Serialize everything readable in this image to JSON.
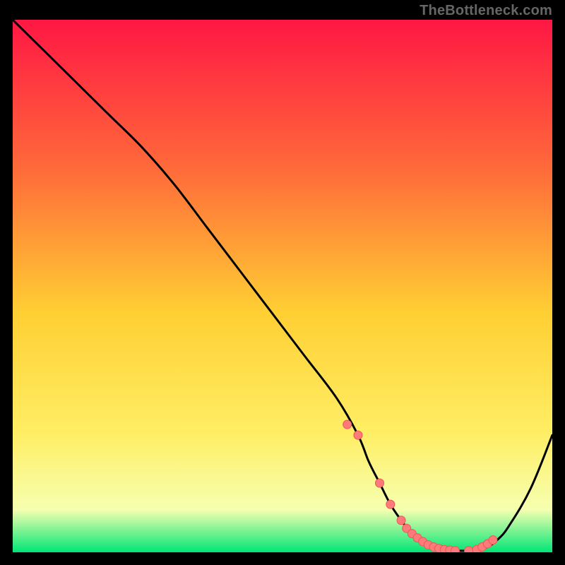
{
  "watermark": {
    "text": "TheBottleneck.com"
  },
  "colors": {
    "black": "#000000",
    "curve": "#000000",
    "marker_fill": "#ff7a7a",
    "marker_stroke": "#ee5555",
    "grad_top": "#ff1744",
    "grad_upper": "#ff6a3a",
    "grad_mid_up": "#ffcf33",
    "grad_mid": "#ffef66",
    "grad_low": "#f6ffb0",
    "grad_bottom": "#00e676"
  },
  "chart_data": {
    "type": "line",
    "title": "",
    "xlabel": "",
    "ylabel": "",
    "xlim": [
      0,
      100
    ],
    "ylim": [
      0,
      100
    ],
    "x": [
      0,
      6,
      12,
      18,
      24,
      30,
      36,
      42,
      48,
      54,
      60,
      64,
      66,
      68,
      70,
      72,
      74,
      76,
      78,
      80,
      82,
      84,
      86,
      88,
      90,
      92,
      96,
      100
    ],
    "values": [
      100,
      94,
      88,
      82,
      76,
      69,
      61,
      53,
      45,
      37,
      29,
      22,
      17,
      13,
      9,
      6,
      3.5,
      2,
      1,
      0.5,
      0.3,
      0.3,
      0.5,
      1,
      2.5,
      5,
      12,
      22
    ],
    "markers": {
      "x": [
        62,
        64,
        68,
        70,
        72,
        73,
        74,
        75,
        76,
        77,
        78,
        79,
        80,
        81,
        82,
        84.5,
        86,
        87,
        88,
        89
      ],
      "y": [
        24,
        22,
        13,
        9,
        6,
        4.5,
        3.5,
        2.7,
        2,
        1.4,
        1,
        0.7,
        0.5,
        0.4,
        0.3,
        0.3,
        0.5,
        1,
        1.6,
        2.3
      ]
    }
  }
}
